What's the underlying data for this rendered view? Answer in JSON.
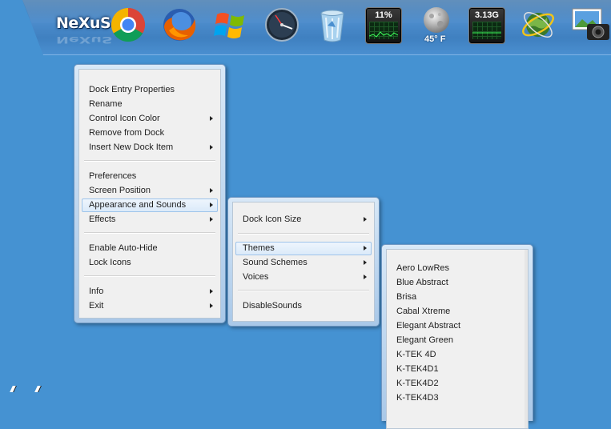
{
  "dock": {
    "brand": "NeXuS",
    "cpu_meter": "11%",
    "weather_temp": "45° F",
    "memory_meter": "3.13G",
    "icons": [
      "nexus-logo",
      "chrome-icon",
      "firefox-icon",
      "windows-icon",
      "clock-icon",
      "recycle-bin-icon",
      "cpu-meter",
      "weather-moon-icon",
      "memory-meter",
      "globe-network-icon",
      "photo-camera-icon"
    ]
  },
  "menu_main": {
    "items": [
      {
        "label": "Dock Entry Properties",
        "submenu": false
      },
      {
        "label": "Rename",
        "submenu": false
      },
      {
        "label": "Control Icon Color",
        "submenu": true
      },
      {
        "label": "Remove from Dock",
        "submenu": false
      },
      {
        "label": "Insert New Dock Item",
        "submenu": true
      },
      {
        "label": "Preferences",
        "submenu": false
      },
      {
        "label": "Screen Position",
        "submenu": true
      },
      {
        "label": "Appearance and Sounds",
        "submenu": true,
        "highlighted": true
      },
      {
        "label": "Effects",
        "submenu": true
      },
      {
        "label": "Enable Auto-Hide",
        "submenu": false
      },
      {
        "label": "Lock Icons",
        "submenu": false
      },
      {
        "label": "Info",
        "submenu": true
      },
      {
        "label": "Exit",
        "submenu": true
      }
    ]
  },
  "menu_appearance": {
    "items": [
      {
        "label": "Dock Icon Size",
        "submenu": true
      },
      {
        "label": "Themes",
        "submenu": true,
        "highlighted": true
      },
      {
        "label": "Sound Schemes",
        "submenu": true
      },
      {
        "label": "Voices",
        "submenu": true
      },
      {
        "label": "DisableSounds",
        "submenu": false
      }
    ]
  },
  "menu_themes": {
    "items": [
      {
        "label": "Aero LowRes"
      },
      {
        "label": "Blue Abstract"
      },
      {
        "label": "Brisa"
      },
      {
        "label": "Cabal Xtreme"
      },
      {
        "label": "Elegant Abstract"
      },
      {
        "label": "Elegant Green"
      },
      {
        "label": "K-TEK 4D"
      },
      {
        "label": "K-TEK4D1"
      },
      {
        "label": "K-TEK4D2"
      },
      {
        "label": "K-TEK4D3"
      }
    ]
  },
  "colors": {
    "desktop": "#4592d2",
    "menu_highlight": "#dbeaf9",
    "menu_background": "#f0f0f0"
  }
}
